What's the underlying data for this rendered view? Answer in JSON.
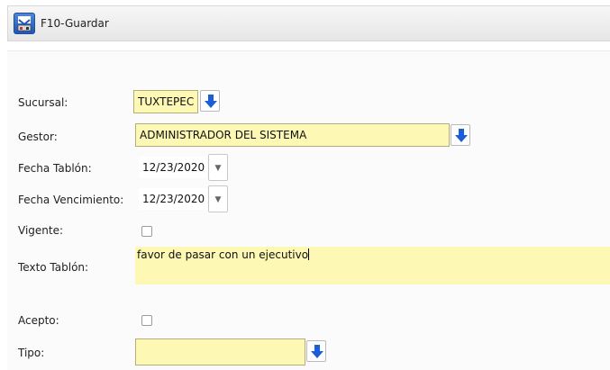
{
  "toolbar": {
    "save_label": "F10-Guardar",
    "save_icon": "save-floppy-icon"
  },
  "form": {
    "sucursal": {
      "label": "Sucursal:",
      "value": "TUXTEPEC"
    },
    "gestor": {
      "label": "Gestor:",
      "value": "ADMINISTRADOR DEL SISTEMA"
    },
    "fecha_tablon": {
      "label": "Fecha Tablón:",
      "value": "12/23/2020"
    },
    "fecha_vencimiento": {
      "label": "Fecha Vencimiento:",
      "value": "12/23/2020"
    },
    "vigente": {
      "label": "Vigente:",
      "checked": false
    },
    "texto_tablon": {
      "label": "Texto Tablón:",
      "value": "favor de pasar con un ejecutivo"
    },
    "acepto": {
      "label": "Acepto:",
      "checked": false
    },
    "tipo": {
      "label": "Tipo:",
      "value": ""
    }
  },
  "colors": {
    "field_yellow": "#fdf8b3",
    "lookup_arrow_blue": "#1a5fd6"
  }
}
